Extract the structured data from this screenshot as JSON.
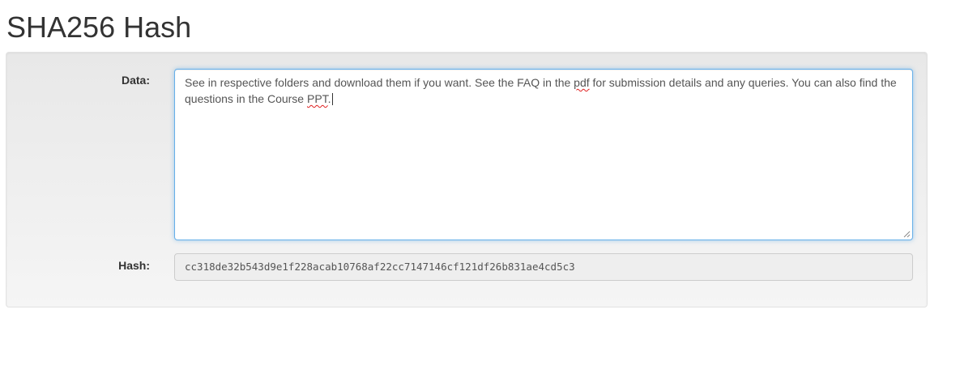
{
  "page": {
    "title": "SHA256 Hash"
  },
  "form": {
    "data_label": "Data:",
    "data_value_parts": [
      "See in respective folders and download them if you want. See the FAQ in the ",
      "pdf",
      " for submission details and any queries. You can also find the questions in the Course ",
      "PPT",
      "."
    ],
    "hash_label": "Hash:",
    "hash_value": "cc318de32b543d9e1f228acab10768af22cc7147146cf121df26b831ae4cd5c3"
  },
  "colors": {
    "focus_border": "#66afe9",
    "spellcheck_underline": "#e02020",
    "well_background": "#f5f5f5",
    "readonly_background": "#eeeeee"
  },
  "icons": {
    "resize_grip": "resize-grip-icon"
  }
}
